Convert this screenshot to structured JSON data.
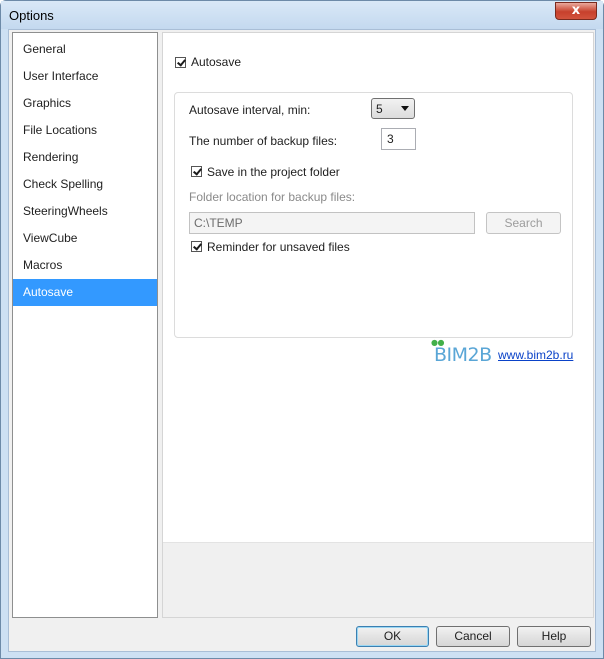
{
  "window": {
    "title": "Options",
    "close_glyph": "x"
  },
  "sidebar": {
    "items": [
      {
        "label": "General",
        "selected": false
      },
      {
        "label": "User Interface",
        "selected": false
      },
      {
        "label": "Graphics",
        "selected": false
      },
      {
        "label": "File Locations",
        "selected": false
      },
      {
        "label": "Rendering",
        "selected": false
      },
      {
        "label": "Check Spelling",
        "selected": false
      },
      {
        "label": "SteeringWheels",
        "selected": false
      },
      {
        "label": "ViewCube",
        "selected": false
      },
      {
        "label": "Macros",
        "selected": false
      },
      {
        "label": "Autosave",
        "selected": true
      }
    ],
    "selected_color": "#3399ff"
  },
  "autosave": {
    "enabled_label": "Autosave",
    "enabled": true,
    "interval_label": "Autosave interval, min:",
    "interval_value": "5",
    "backup_count_label": "The number of backup files:",
    "backup_count_value": "3",
    "save_in_project_label": "Save in the project folder",
    "save_in_project": true,
    "folder_location_label": "Folder location for backup files:",
    "folder_path": "C:\\TEMP",
    "search_label": "Search",
    "reminder_label": "Reminder for unsaved files",
    "reminder": true
  },
  "branding": {
    "logo_text": "BIM2B",
    "site_link": "www.bim2b.ru",
    "logo_color": "#5aa6d6"
  },
  "footer": {
    "ok_label": "OK",
    "cancel_label": "Cancel",
    "help_label": "Help"
  }
}
